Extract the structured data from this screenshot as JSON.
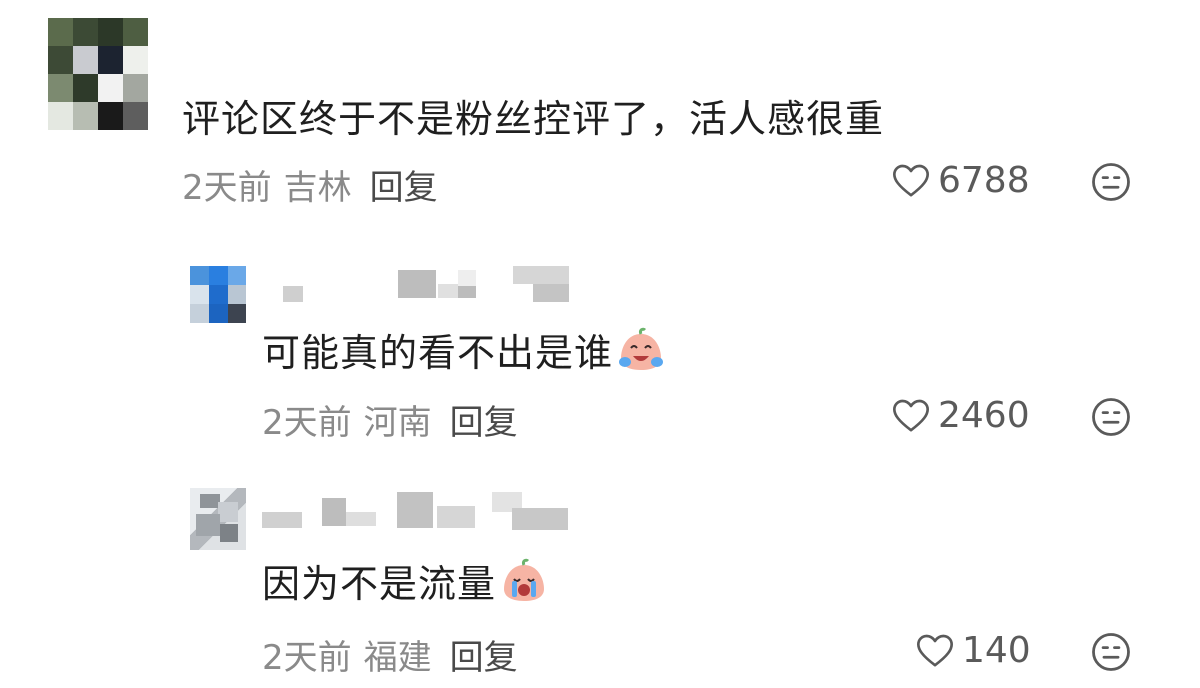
{
  "comments": [
    {
      "text": "评论区终于不是粉丝控评了，活人感很重",
      "time": "2天前",
      "location": "吉林",
      "reply_label": "回复",
      "likes": "6788",
      "icons": {
        "like": "heart-outline-icon",
        "dislike": "meh-face-icon"
      }
    },
    {
      "text": "可能真的看不出是谁",
      "emoji": "crying-laughing-peach-emoji",
      "time": "2天前",
      "location": "河南",
      "reply_label": "回复",
      "likes": "2460",
      "icons": {
        "like": "heart-outline-icon",
        "dislike": "meh-face-icon"
      }
    },
    {
      "text": "因为不是流量",
      "emoji": "crying-peach-emoji",
      "time": "2天前",
      "location": "福建",
      "reply_label": "回复",
      "likes": "140",
      "icons": {
        "like": "heart-outline-icon",
        "dislike": "meh-face-icon"
      }
    }
  ],
  "colors": {
    "text": "#1f1f1f",
    "meta": "#8a8a8a",
    "reply": "#4a4a4a",
    "icon": "#5a5a5a"
  }
}
